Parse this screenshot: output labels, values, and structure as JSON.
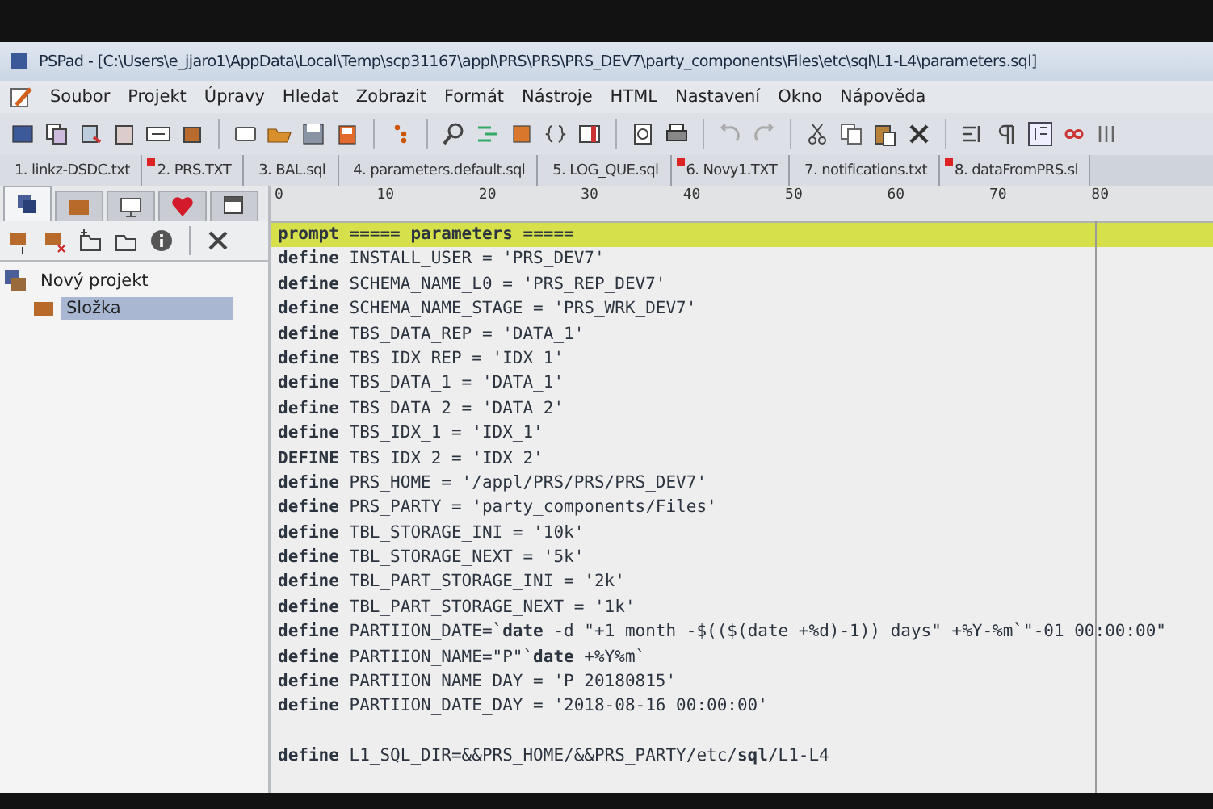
{
  "window": {
    "title": "PSPad - [C:\\Users\\e_jjaro1\\AppData\\Local\\Temp\\scp31167\\appl\\PRS\\PRS\\PRS_DEV7\\party_components\\Files\\etc\\sql\\L1-L4\\parameters.sql]"
  },
  "menu": [
    "Soubor",
    "Projekt",
    "Úpravy",
    "Hledat",
    "Zobrazit",
    "Formát",
    "Nástroje",
    "HTML",
    "Nastavení",
    "Okno",
    "Nápověda"
  ],
  "tabs": [
    {
      "label": "1. linkz-DSDC.txt",
      "modified": false
    },
    {
      "label": "2. PRS.TXT",
      "modified": true
    },
    {
      "label": "3. BAL.sql",
      "modified": false
    },
    {
      "label": "4. parameters.default.sql",
      "modified": false
    },
    {
      "label": "5. LOG_QUE.sql",
      "modified": false
    },
    {
      "label": "6. Novy1.TXT",
      "modified": true
    },
    {
      "label": "7. notifications.txt",
      "modified": false
    },
    {
      "label": "8. dataFromPRS.sl",
      "modified": true
    }
  ],
  "side_tabs": [
    {
      "kind": "project",
      "selected": true
    },
    {
      "kind": "folder",
      "selected": false
    },
    {
      "kind": "screen",
      "selected": false
    },
    {
      "kind": "heart",
      "selected": false
    },
    {
      "kind": "windows",
      "selected": false
    }
  ],
  "tree": [
    {
      "label": "Nový projekt",
      "selected": false,
      "children": [
        {
          "label": "Složka",
          "selected": true
        }
      ]
    }
  ],
  "ruler": [
    "0",
    "10",
    "20",
    "30",
    "40",
    "50",
    "60",
    "70",
    "80"
  ],
  "code_lines": [
    {
      "text": "**prompt** ===== **parameters** =====",
      "highlighted": true
    },
    {
      "text": "**define** INSTALL_USER = 'PRS_DEV7'",
      "highlighted": false
    },
    {
      "text": "**define** SCHEMA_NAME_L0 = 'PRS_REP_DEV7'",
      "highlighted": false
    },
    {
      "text": "**define** SCHEMA_NAME_STAGE = 'PRS_WRK_DEV7'",
      "highlighted": false
    },
    {
      "text": "**define** TBS_DATA_REP = 'DATA_1'",
      "highlighted": false
    },
    {
      "text": "**define** TBS_IDX_REP = 'IDX_1'",
      "highlighted": false
    },
    {
      "text": "**define** TBS_DATA_1 = 'DATA_1'",
      "highlighted": false
    },
    {
      "text": "**define** TBS_DATA_2 = 'DATA_2'",
      "highlighted": false
    },
    {
      "text": "**define** TBS_IDX_1 = 'IDX_1'",
      "highlighted": false
    },
    {
      "text": "**DEFINE** TBS_IDX_2 = 'IDX_2'",
      "highlighted": false
    },
    {
      "text": "**define** PRS_HOME = '/appl/PRS/PRS/PRS_DEV7'",
      "highlighted": false
    },
    {
      "text": "**define** PRS_PARTY = 'party_components/Files'",
      "highlighted": false
    },
    {
      "text": "**define** TBL_STORAGE_INI = '10k'",
      "highlighted": false
    },
    {
      "text": "**define** TBL_STORAGE_NEXT = '5k'",
      "highlighted": false
    },
    {
      "text": "**define** TBL_PART_STORAGE_INI = '2k'",
      "highlighted": false
    },
    {
      "text": "**define** TBL_PART_STORAGE_NEXT = '1k'",
      "highlighted": false
    },
    {
      "text": "**define** PARTIION_DATE=`**date** -d \"+1 month -$(($(date +%d)-1)) days\" +%Y-%m`\"-01 00:00:00\"",
      "highlighted": false
    },
    {
      "text": "**define** PARTIION_NAME=\"P\"`**date** +%Y%m`",
      "highlighted": false
    },
    {
      "text": "**define** PARTIION_NAME_DAY = 'P_20180815'",
      "highlighted": false
    },
    {
      "text": "**define** PARTIION_DATE_DAY = '2018-08-16 00:00:00'",
      "highlighted": false
    },
    {
      "kind": "blank"
    },
    {
      "text": "**define** L1_SQL_DIR=&&PRS_HOME/&&PRS_PARTY/etc/**sql**/L1-L4",
      "highlighted": false
    }
  ]
}
